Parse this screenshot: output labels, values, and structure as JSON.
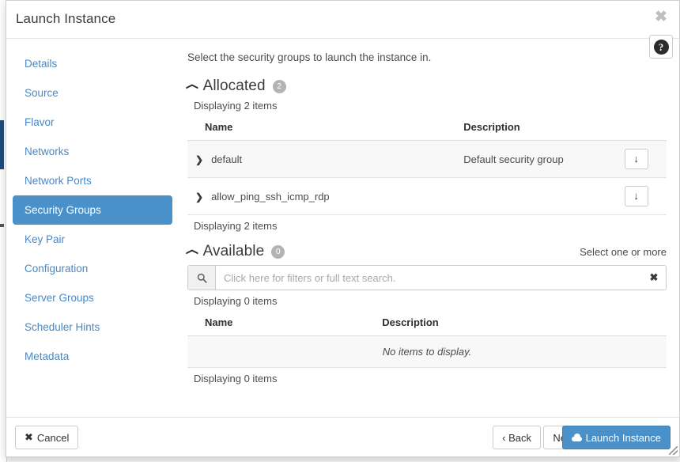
{
  "modal": {
    "title": "Launch Instance",
    "close_icon": "close-icon",
    "help_icon": "help-icon",
    "help_glyph": "?"
  },
  "sidebar": {
    "items": [
      {
        "label": "Details",
        "active": false
      },
      {
        "label": "Source",
        "active": false
      },
      {
        "label": "Flavor",
        "active": false
      },
      {
        "label": "Networks",
        "active": false
      },
      {
        "label": "Network Ports",
        "active": false
      },
      {
        "label": "Security Groups",
        "active": true
      },
      {
        "label": "Key Pair",
        "active": false
      },
      {
        "label": "Configuration",
        "active": false
      },
      {
        "label": "Server Groups",
        "active": false
      },
      {
        "label": "Scheduler Hints",
        "active": false
      },
      {
        "label": "Metadata",
        "active": false
      }
    ]
  },
  "main": {
    "instructions": "Select the security groups to launch the instance in.",
    "allocated": {
      "chevron": "⌄",
      "title": "Allocated",
      "count": "2",
      "count_top_label": "Displaying 2 items",
      "count_bottom_label": "Displaying 2 items",
      "columns": {
        "name": "Name",
        "description": "Description"
      },
      "rows": [
        {
          "expander": "❯",
          "name": "default",
          "description": "Default security group",
          "action_icon": "↓",
          "action_name": "deallocate-button"
        },
        {
          "expander": "❯",
          "name": "allow_ping_ssh_icmp_rdp",
          "description": "",
          "action_icon": "↓",
          "action_name": "deallocate-button"
        }
      ]
    },
    "available": {
      "chevron": "⌄",
      "title": "Available",
      "count": "0",
      "hint": "Select one or more",
      "search": {
        "icon": "search-icon",
        "icon_glyph": "⌕",
        "value": "",
        "placeholder": "Click here for filters or full text search.",
        "clear_glyph": "✖"
      },
      "count_top_label": "Displaying 0 items",
      "count_bottom_label": "Displaying 0 items",
      "columns": {
        "name": "Name",
        "description": "Description"
      },
      "empty_message": "No items to display."
    }
  },
  "footer": {
    "cancel": {
      "label": "Cancel",
      "icon_glyph": "✖"
    },
    "back": {
      "label": "‹ Back"
    },
    "next": {
      "label": "Next ›"
    },
    "launch": {
      "label": "Launch Instance",
      "icon": "cloud-icon"
    }
  },
  "colors": {
    "accent_blue": "#4a90c9",
    "link_blue": "#4a87c4",
    "badge_gray": "#b3b3b3",
    "row_stripe": "#f8f8f8"
  }
}
